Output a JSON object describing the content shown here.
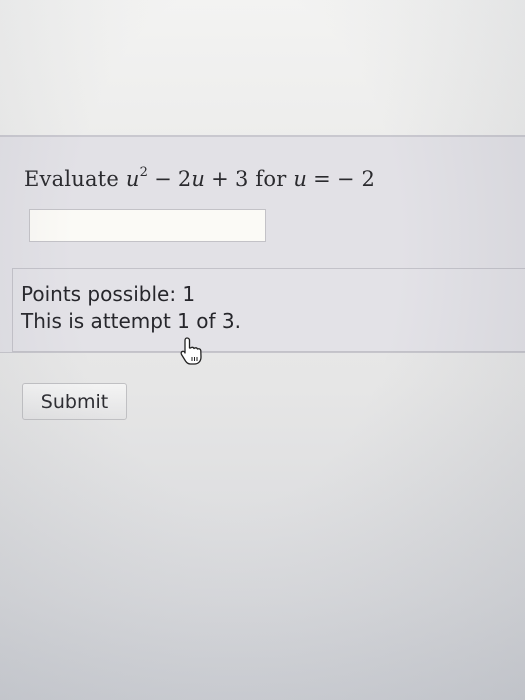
{
  "question": {
    "prefix": "Evaluate",
    "var_u": "u",
    "exponent": "2",
    "op_minus": "−",
    "term_2u": "2u",
    "op_plus": "+",
    "const_3": "3",
    "for_word": "for",
    "var_u2": "u",
    "op_eq": "=",
    "value": "− 2"
  },
  "answer_input": {
    "value": ""
  },
  "info": {
    "points_possible": "Points possible: 1",
    "attempt": "This is attempt 1 of 3."
  },
  "cursor": {
    "icon": "hand-pointer-icon"
  },
  "submit": {
    "label": "Submit"
  }
}
